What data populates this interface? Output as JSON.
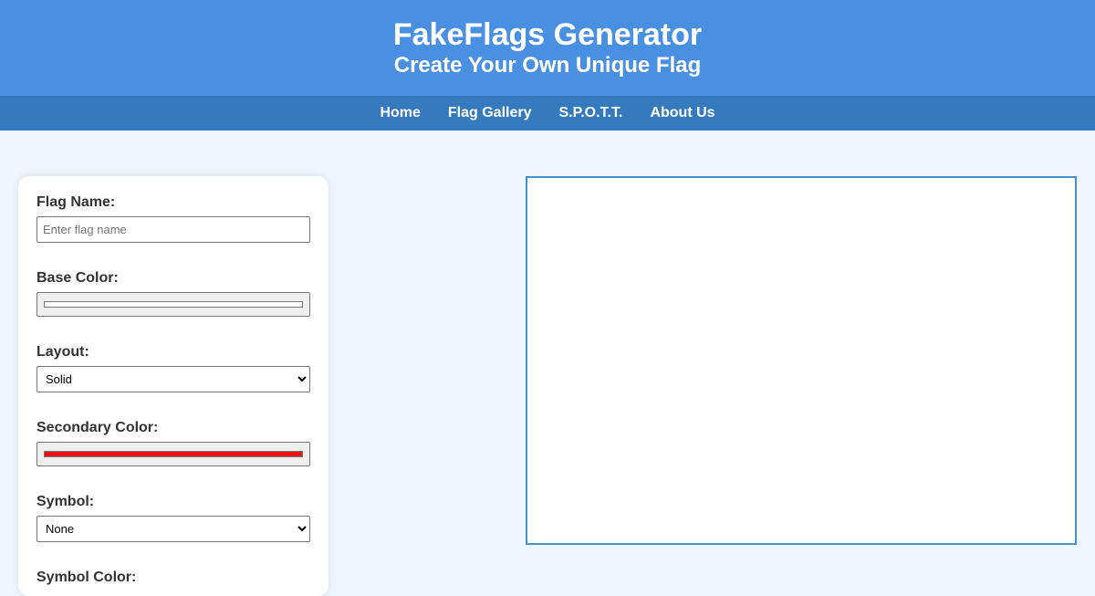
{
  "header": {
    "title": "FakeFlags Generator",
    "subtitle": "Create Your Own Unique Flag"
  },
  "nav": {
    "items": [
      {
        "label": "Home"
      },
      {
        "label": "Flag Gallery"
      },
      {
        "label": "S.P.O.T.T."
      },
      {
        "label": "About Us"
      }
    ]
  },
  "form": {
    "flag_name": {
      "label": "Flag Name:",
      "value": "",
      "placeholder": "Enter flag name"
    },
    "base_color": {
      "label": "Base Color:",
      "value": "#ffffff"
    },
    "layout": {
      "label": "Layout:",
      "selected": "Solid"
    },
    "secondary_color": {
      "label": "Secondary Color:",
      "value": "#e81416"
    },
    "symbol": {
      "label": "Symbol:",
      "selected": "None"
    },
    "symbol_color": {
      "label": "Symbol Color:"
    }
  },
  "colors": {
    "header_bg": "#4a90e2",
    "nav_bg": "#357abd",
    "page_bg": "#eef7fe",
    "preview_border": "#4a90c8"
  }
}
